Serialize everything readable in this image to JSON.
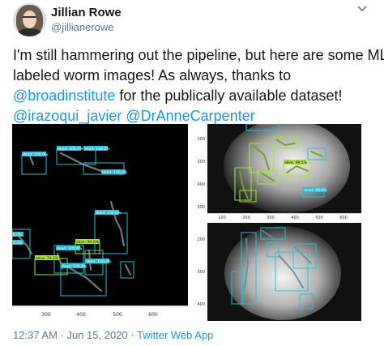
{
  "author": {
    "name": "Jillian Rowe",
    "handle": "@jillianerowe"
  },
  "tweet": {
    "line1": "I'm still hammering out the pipeline, but here are some ML",
    "line2": "labeled worm images! As always, thanks to",
    "mention_broad": "@broadinstitute",
    "line3_rest": " for the publically available dataset!",
    "mention_irazoqui": "@irazoqui_javier",
    "mention_carpenter": "@DrAnneCarpenter"
  },
  "images": {
    "left": {
      "x_ticks": [
        "300",
        "400",
        "500",
        "600"
      ],
      "labels": {
        "l1": "dead: 100.0%",
        "l2": "dead: 100.0%",
        "l3": "dead: 100.0%",
        "l4": "dead: 100.0%",
        "l5": "dead: 100.0%",
        "l6": "alive: 99.9%",
        "l7": "dead: 100.0%",
        "l8": "alive: 79.3%",
        "l9": "dead: 100.0%",
        "l10": "dead: 100.0%",
        "l11": "0.0%",
        "l12": "0.0%"
      }
    },
    "top_right": {
      "x_ticks": [
        "100",
        "200",
        "300",
        "400",
        "500",
        "600"
      ],
      "y_ticks": [
        "200",
        "300",
        "400",
        "500"
      ],
      "labels": {
        "l1": "alive: 99.5%",
        "l2": "dead: 98.6%"
      }
    },
    "bottom_right": {
      "y_ticks": [
        "200",
        "300",
        "400"
      ]
    }
  },
  "footer": {
    "timestamp": "12:37 AM · Jun 15, 2020 · ",
    "source": "Twitter Web App"
  },
  "colors": {
    "link": "#1b95e0",
    "secondary_text": "#657786",
    "box_cyan": "#27c0d6",
    "box_green": "#a6e22e"
  }
}
